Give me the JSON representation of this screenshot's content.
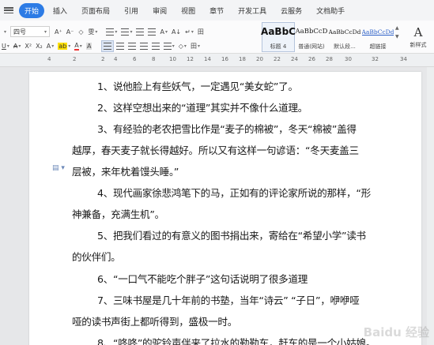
{
  "tabs": [
    {
      "label": "开始",
      "active": true
    },
    {
      "label": "插入"
    },
    {
      "label": "页面布局"
    },
    {
      "label": "引用"
    },
    {
      "label": "审阅"
    },
    {
      "label": "视图"
    },
    {
      "label": "章节"
    },
    {
      "label": "开发工具"
    },
    {
      "label": "云服务"
    },
    {
      "label": "文档助手"
    }
  ],
  "ribbon": {
    "font_size": "四号",
    "grow_font": "A⁺",
    "shrink_font": "A⁻",
    "clear_format": "◇",
    "phonetic": "雯",
    "underline": "U",
    "strike": "A",
    "superscript": "X²",
    "subscript": "X₂",
    "text_effect": "A",
    "highlight": "ab",
    "font_color": "A",
    "char_shade": "A",
    "chinese_layout": "A",
    "sort_icon": "A↓",
    "show_hide": "↵",
    "border": "田",
    "shading": "◇"
  },
  "styles": [
    {
      "sample": "AaBbC",
      "label": "标题 4",
      "selected": true
    },
    {
      "sample": "AaBbCcD",
      "label": "普通(网站)"
    },
    {
      "sample": "AaBbCcDd",
      "label": "默认段..."
    },
    {
      "sample": "AaBbCcDd",
      "label": "超链接",
      "color": "#2b5fc7"
    }
  ],
  "new_style": {
    "glyph": "A",
    "label": "新样式"
  },
  "ruler_numbers": [
    "4",
    "2",
    "2",
    "4",
    "6",
    "8",
    "10",
    "12",
    "14",
    "16",
    "18",
    "20",
    "22",
    "24",
    "26",
    "28",
    "30",
    "32",
    "34"
  ],
  "document": {
    "lines": [
      "1、说他脸上有些妖气，一定遇见“美女蛇”了。",
      "2、这样空想出来的“道理”其实并不像什么道理。",
      "3、有经验的老农把雪比作是“麦子的棉被”，冬天“棉被”盖得",
      "越厚，春天麦子就长得越好。所以又有这样一句谚语：“冬天麦盖三",
      "层被，来年枕着馒头睡。”",
      "4、现代画家徐悲鸿笔下的马，正如有的评论家所说的那样，“形",
      "神兼备，充满生机”。",
      "5、把我们看过的有意义的图书捐出来，寄给在“希望小学”读书",
      "的伙伴们。",
      "6、“一口气不能吃个胖子”这句话说明了很多道理",
      "7、三味书屋是几十年前的书塾，当年“诗云” “子日”，咿咿哑",
      "哑的读书声街上都听得到，盛极一时。",
      "8、“咚咚”的驼铃声伴来了拉水的勒勒车，赶车的是一个小姑娘。"
    ]
  },
  "watermark": "Baidu 经验"
}
